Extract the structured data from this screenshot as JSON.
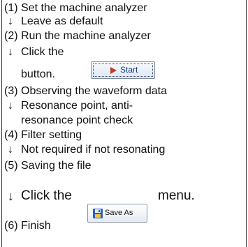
{
  "steps": [
    {
      "text": "(1) Set the machine analyzer"
    },
    {
      "text": "(2) Run the machine analyzer"
    },
    {
      "text": "(3) Observing the waveform data"
    },
    {
      "text": "(4) Filter setting"
    },
    {
      "text": "(5) Saving the file"
    },
    {
      "text": "(6) Finish"
    }
  ],
  "arrow_char": "↓",
  "notes": {
    "leave_default": "Leave as default",
    "click_the_1": "Click the",
    "button_word": "button.",
    "resonance_1": "Resonance point, anti-",
    "resonance_2": "resonance point check",
    "not_required": "Not required if not resonating",
    "click_the_2": "Click the",
    "menu_word": "menu."
  },
  "buttons": {
    "start_label": "Start",
    "save_as_label": "Save As"
  }
}
